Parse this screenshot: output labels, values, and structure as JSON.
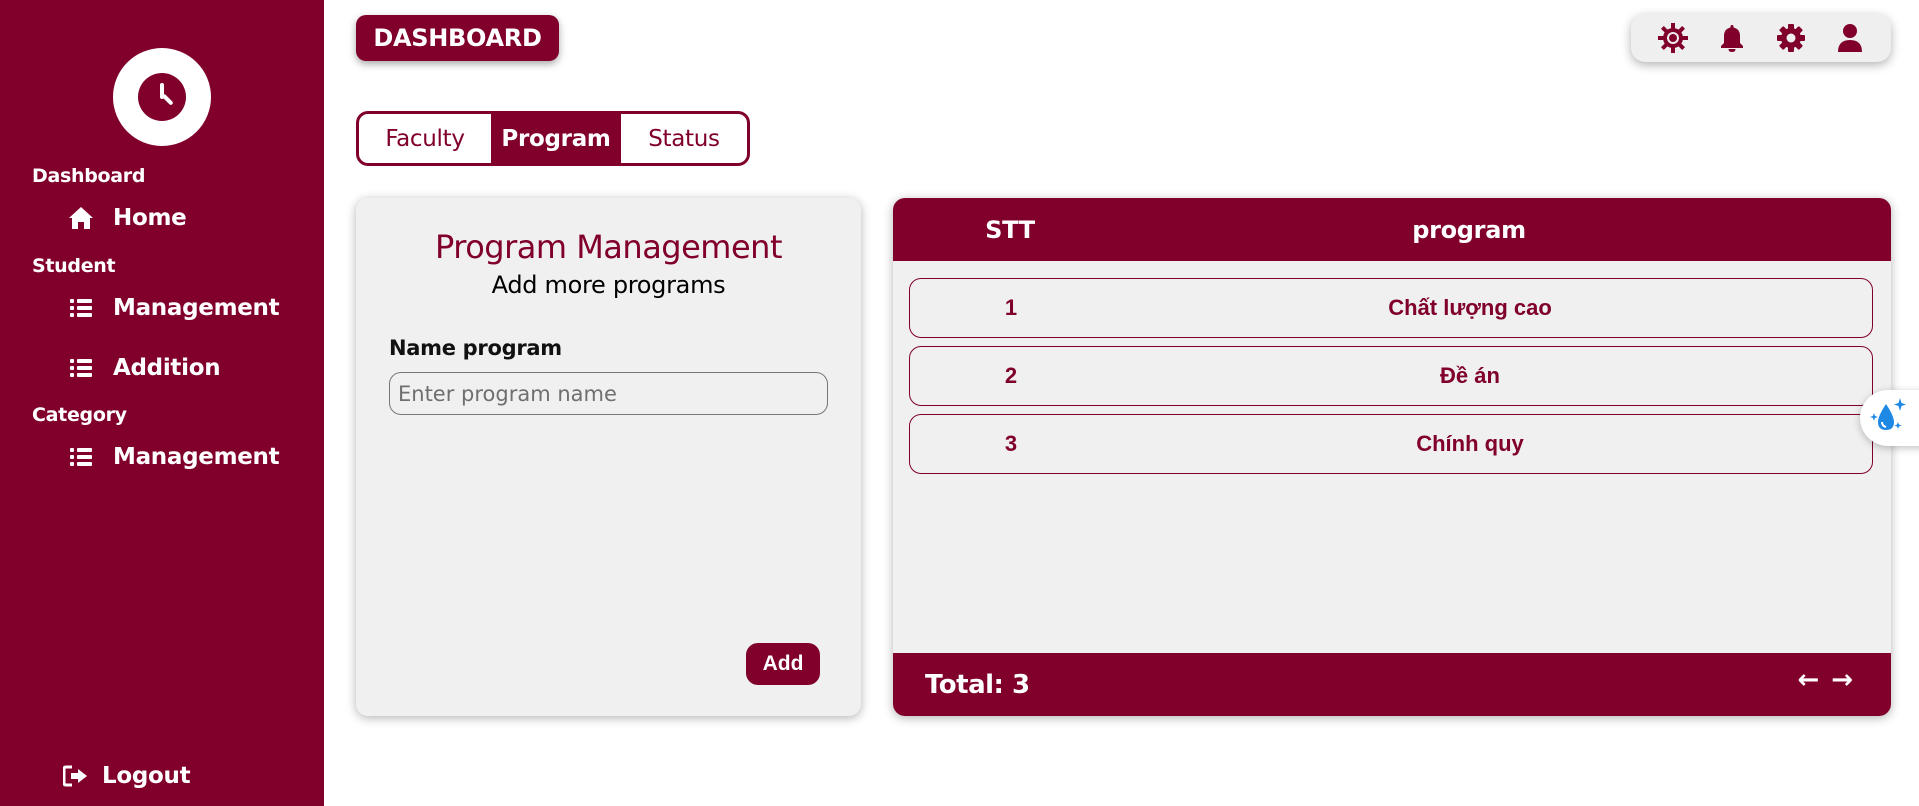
{
  "sidebar": {
    "sections": {
      "dashboard": "Dashboard",
      "student": "Student",
      "category": "Category"
    },
    "items": {
      "home": "Home",
      "student_management": "Management",
      "student_addition": "Addition",
      "category_management": "Management"
    },
    "logout": "Logout"
  },
  "header": {
    "dashboard_button": "DASHBOARD",
    "icons": [
      "sun-gear-icon",
      "bell-icon",
      "gear-icon",
      "user-icon"
    ]
  },
  "tabs": [
    {
      "label": "Faculty",
      "active": false
    },
    {
      "label": "Program",
      "active": true
    },
    {
      "label": "Status",
      "active": false
    }
  ],
  "form": {
    "title": "Program Management",
    "subtitle": "Add more programs",
    "field_label": "Name program",
    "placeholder": "Enter program name",
    "value": "",
    "add_button": "Add"
  },
  "table": {
    "columns": [
      "STT",
      "program"
    ],
    "rows": [
      {
        "stt": "1",
        "program": "Chất lượng cao"
      },
      {
        "stt": "2",
        "program": "Đề án"
      },
      {
        "stt": "3",
        "program": "Chính quy"
      }
    ],
    "total_label": "Total: 3",
    "prev": "←",
    "next": "→"
  },
  "colors": {
    "primary": "#80002b",
    "panel": "#f0f0f0",
    "widget_blue": "#1e88e5"
  }
}
